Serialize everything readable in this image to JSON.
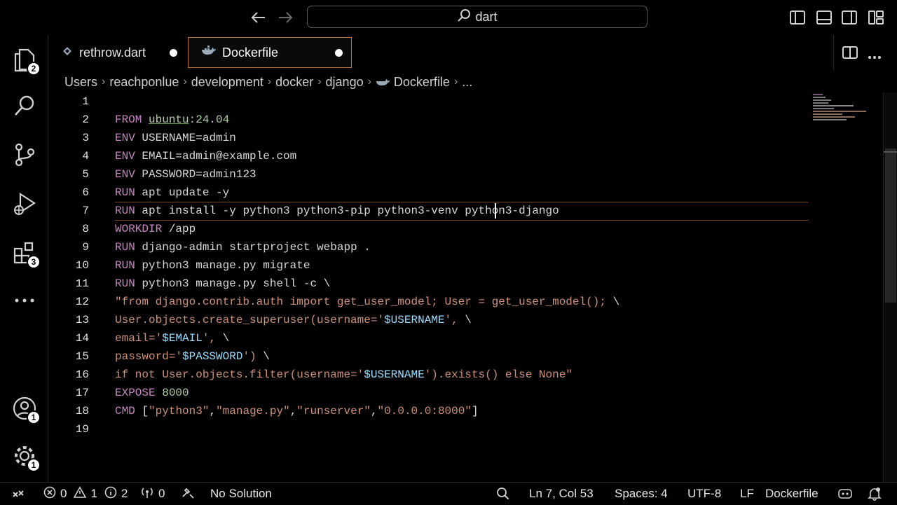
{
  "titlebar": {
    "search_text": "dart"
  },
  "activity": {
    "explorer_badge": "2",
    "extensions_badge": "3",
    "accounts_badge": "1",
    "settings_badge": "1"
  },
  "tabs": [
    {
      "label": "rethrow.dart",
      "icon": "dart-icon",
      "dirty": true
    },
    {
      "label": "Dockerfile",
      "icon": "docker-icon",
      "dirty": true,
      "active": true
    }
  ],
  "breadcrumb": [
    "Users",
    "reachponlue",
    "development",
    "docker",
    "django",
    "Dockerfile",
    "..."
  ],
  "editor": {
    "line_numbers": [
      "1",
      "2",
      "3",
      "4",
      "5",
      "6",
      "7",
      "8",
      "9",
      "10",
      "11",
      "12",
      "13",
      "14",
      "15",
      "16",
      "17",
      "18",
      "19"
    ],
    "lines": {
      "l2": {
        "kw": "FROM",
        "image": "ubuntu",
        "tag": ":24.04"
      },
      "l3": {
        "kw": "ENV",
        "text": "USERNAME=admin"
      },
      "l4": {
        "kw": "ENV",
        "text": "EMAIL=admin@example.com"
      },
      "l5": {
        "kw": "ENV",
        "text": "PASSWORD=admin123"
      },
      "l6": {
        "kw": "RUN",
        "text": "apt update -y"
      },
      "l7": {
        "kw": "RUN",
        "text": "apt install -y python3 python3-pip python3-venv python3-django"
      },
      "l8": {
        "kw": "WORKDIR",
        "text": "/app"
      },
      "l9": {
        "kw": "RUN",
        "text": "django-admin startproject webapp ."
      },
      "l10": {
        "kw": "RUN",
        "text": "python3 manage.py migrate"
      },
      "l11": {
        "kw": "RUN",
        "text": "python3 manage.py shell -c \\"
      },
      "l12": {
        "str": "\"from django.contrib.auth import get_user_model; User = get_user_model();",
        "tail": " \\"
      },
      "l13": {
        "a": "User.objects.create_superuser(username='",
        "var": "$USERNAME",
        "b": "',",
        "tail": " \\"
      },
      "l14": {
        "a": "email='",
        "var": "$EMAIL",
        "b": "',",
        "tail": " \\"
      },
      "l15": {
        "a": "password='",
        "var": "$PASSWORD",
        "b": "')",
        "tail": " \\"
      },
      "l16": {
        "a": "if not User.objects.filter(username='",
        "var": "$USERNAME",
        "b": "').exists() else None\""
      },
      "l17": {
        "kw": "EXPOSE",
        "num": "8000"
      },
      "l18": {
        "kw": "CMD",
        "open": "[",
        "s1": "\"python3\"",
        "s2": "\"manage.py\"",
        "s3": "\"runserver\"",
        "s4": "\"0.0.0.0:8000\"",
        "close": "]"
      }
    }
  },
  "statusbar": {
    "errors": "0",
    "warnings": "1",
    "infos": "2",
    "ports": "0",
    "solution": "No Solution",
    "position": "Ln 7, Col 53",
    "spaces": "Spaces: 4",
    "encoding": "UTF-8",
    "eol": "LF",
    "language": "Dockerfile"
  },
  "colors": {
    "keyword": "#c586c0",
    "string": "#ce9178",
    "variable": "#9cdcfe",
    "active_tab_border": "#b8733f"
  }
}
